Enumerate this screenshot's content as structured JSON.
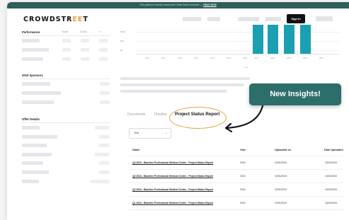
{
  "banner": {
    "text": "This platform recently announced 'Other Bold Insurance' —",
    "link": "READ NOW"
  },
  "header": {
    "logo_prefix": "CROWDSTR",
    "logo_accent": "EE",
    "logo_suffix": "T",
    "signin_label": "Sign In"
  },
  "sidebar": {
    "performance_title": "Performance",
    "performance_cols": [
      "Target",
      "Actual",
      "+/-"
    ],
    "sponsors_title": "2019 Sponsors",
    "offer_title": "Offer Details"
  },
  "chart_data": {
    "type": "bar",
    "ytick_labels": [
      "$$$$",
      "$$$",
      "$$"
    ],
    "xtick_labels": [
      "2010",
      "2011",
      "2012",
      "2013",
      "2014",
      "2015",
      "2016",
      "2017",
      "2018",
      "2019",
      "2020",
      "2021"
    ],
    "xlabel": "Year"
  },
  "callout": {
    "text": "New Insights!"
  },
  "tabs": [
    {
      "label": "Documents"
    },
    {
      "label": "Timeline"
    },
    {
      "label": "Project Status Report"
    }
  ],
  "filter": {
    "value": "Year",
    "caret": "⌄"
  },
  "table": {
    "headers": [
      "Name",
      "Year",
      "Uploaded on",
      "Date Uploaded"
    ],
    "rows": [
      {
        "name": "Q4 2024 - Baseline Professional Medical Centre - Project Status Report",
        "year": "2024",
        "uploaded": "10/01/2024",
        "date": "10/01/2024"
      },
      {
        "name": "Q3 2024 - Baseline Professional Medical Centre - Project Status Report",
        "year": "2024",
        "uploaded": "10/01/2024",
        "date": "10/01/2024"
      },
      {
        "name": "Q2 2024 - Baseline Professional Medical Centre - Project Status Report",
        "year": "2024",
        "uploaded": "10/01/2024",
        "date": "10/01/2024"
      },
      {
        "name": "Q1 2024 - Baseline Professional Medical Centre - Project Status Report",
        "year": "2024",
        "uploaded": "10/01/2024",
        "date": "10/01/2024"
      }
    ]
  }
}
